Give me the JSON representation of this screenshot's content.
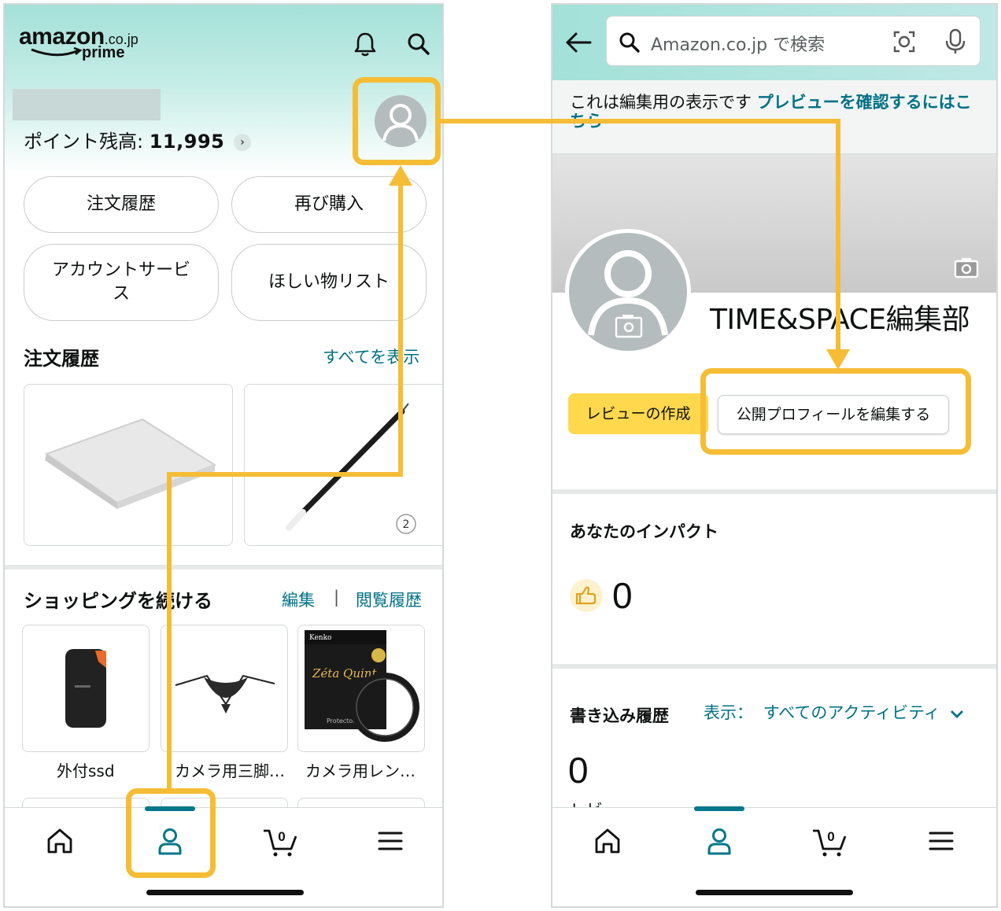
{
  "left": {
    "logo": {
      "word": "amazon",
      "tld": ".co.jp",
      "sub": "prime"
    },
    "points": {
      "label": "ポイント残高:",
      "value": "11,995"
    },
    "buttons": [
      "注文履歴",
      "再び購入",
      "アカウントサービス",
      "ほしい物リスト"
    ],
    "orders": {
      "title": "注文履歴",
      "link": "すべてを表示",
      "badge": "2"
    },
    "continue": {
      "title": "ショッピングを続ける",
      "edit": "編集",
      "sep": "|",
      "history": "閲覧履歴"
    },
    "products": [
      {
        "label": "外付ssd"
      },
      {
        "label": "カメラ用三脚…"
      },
      {
        "label": "カメラ用レン…"
      }
    ],
    "filter_box_text": {
      "brand": "Kenko",
      "name": "Zéta Quint",
      "sub": "Protector"
    }
  },
  "right": {
    "search": {
      "placeholder": "Amazon.co.jp で検索"
    },
    "notice": {
      "text": "これは編集用の表示です ",
      "link": "プレビューを確認するにはこちら"
    },
    "profile_name": "TIME&SPACE編集部",
    "review_button": "レビューの作成",
    "edit_button": "公開プロフィールを編集する",
    "impact": {
      "title": "あなたのインパクト",
      "value": "0"
    },
    "history": {
      "title": "書き込み履歴",
      "filter_label": "表示：",
      "filter_value": "すべてのアクティビティ",
      "count": "0",
      "count_label": "レビュー"
    }
  },
  "tabbar": {
    "cart_count": "0"
  },
  "colors": {
    "accent_teal": "#00778a",
    "link": "#007185",
    "highlight": "#f5bd36",
    "button_yellow": "#ffd84d"
  }
}
